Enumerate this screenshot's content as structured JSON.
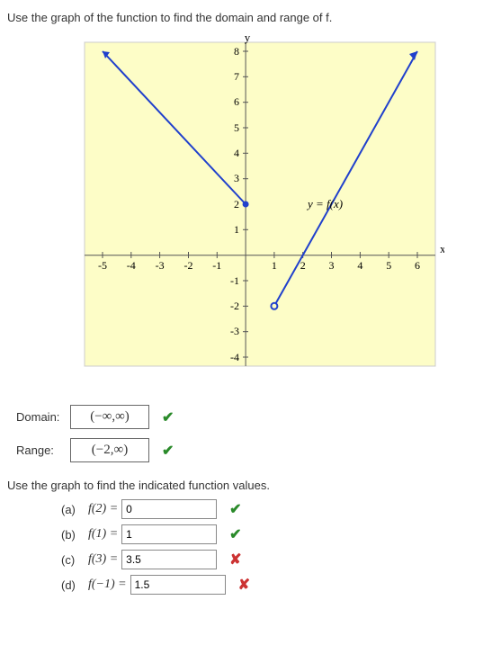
{
  "instruction1": "Use the graph of the function to find the domain and range of f.",
  "instruction2": "Use the graph to find the indicated function values.",
  "graph": {
    "x_label": "x",
    "y_label": "y",
    "y_ticks": [
      "8",
      "7",
      "6",
      "5",
      "4",
      "3",
      "2",
      "1",
      "-1",
      "-2",
      "-3",
      "-4"
    ],
    "x_ticks": [
      "-5",
      "-4",
      "-3",
      "-2",
      "-1",
      "1",
      "2",
      "3",
      "4",
      "5",
      "6"
    ],
    "fn_label": "y = f(x)"
  },
  "domain": {
    "label": "Domain:",
    "value": "(−∞,∞)"
  },
  "range": {
    "label": "Range:",
    "value": "(−2,∞)"
  },
  "parts": {
    "a": {
      "letter": "(a)",
      "expr": "f(2) =",
      "value": "0",
      "correct": true
    },
    "b": {
      "letter": "(b)",
      "expr": "f(1) =",
      "value": "1",
      "correct": true
    },
    "c": {
      "letter": "(c)",
      "expr": "f(3) =",
      "value": "3.5",
      "correct": false
    },
    "d": {
      "letter": "(d)",
      "expr": "f(−1) =",
      "value": "1.5",
      "correct": false
    }
  },
  "chart_data": {
    "type": "line",
    "title": "y = f(x)",
    "xlabel": "x",
    "ylabel": "y",
    "xlim": [
      -5,
      6
    ],
    "ylim": [
      -4,
      8
    ],
    "series": [
      {
        "name": "left ray",
        "x": [
          -5,
          0
        ],
        "y": [
          8,
          2
        ],
        "arrow_start": true
      },
      {
        "name": "right ray",
        "x": [
          1,
          6
        ],
        "y": [
          -2,
          8
        ],
        "arrow_end": true,
        "open_start": true
      }
    ],
    "annotations": [
      {
        "text": "y = f(x)",
        "x": 3,
        "y": 2
      }
    ]
  }
}
